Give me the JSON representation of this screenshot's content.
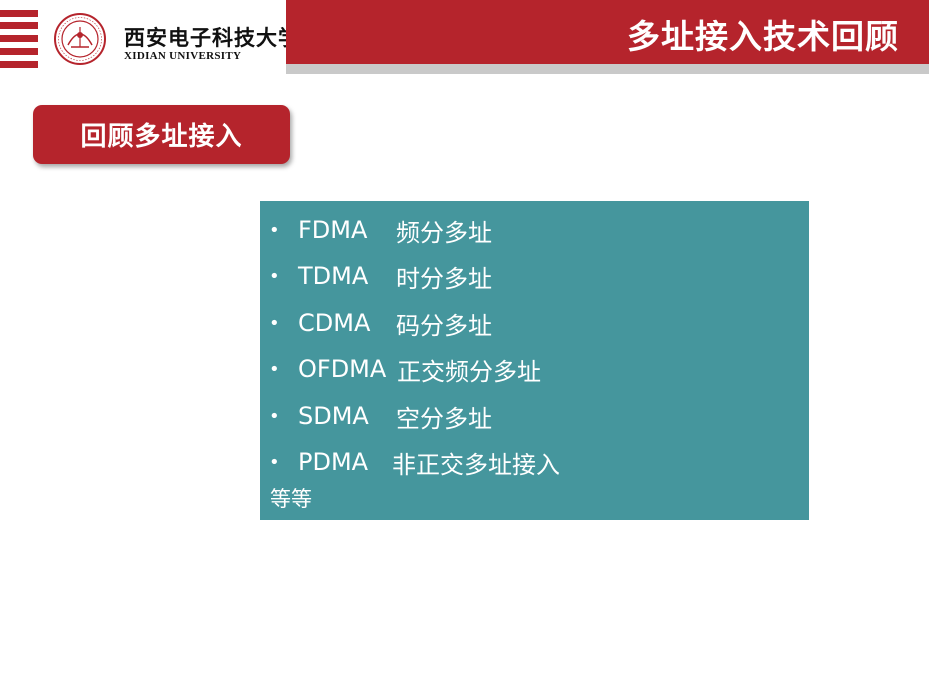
{
  "header": {
    "university_cn": "西安电子科技大学",
    "university_en": "XIDIAN UNIVERSITY",
    "slide_title": "多址接入技术回顾",
    "brand_color": "#b5242c"
  },
  "section": {
    "label": "回顾多址接入"
  },
  "content": {
    "box_color": "#45969d",
    "bullet_symbol": "•",
    "items": [
      {
        "abbr": "FDMA",
        "desc": "频分多址"
      },
      {
        "abbr": "TDMA",
        "desc": "时分多址"
      },
      {
        "abbr": "CDMA",
        "desc": "码分多址"
      },
      {
        "abbr": "OFDMA",
        "desc": "正交频分多址"
      },
      {
        "abbr": "SDMA",
        "desc": "空分多址"
      },
      {
        "abbr": "PDMA",
        "desc": "非正交多址接入"
      }
    ],
    "tail": "等等"
  }
}
